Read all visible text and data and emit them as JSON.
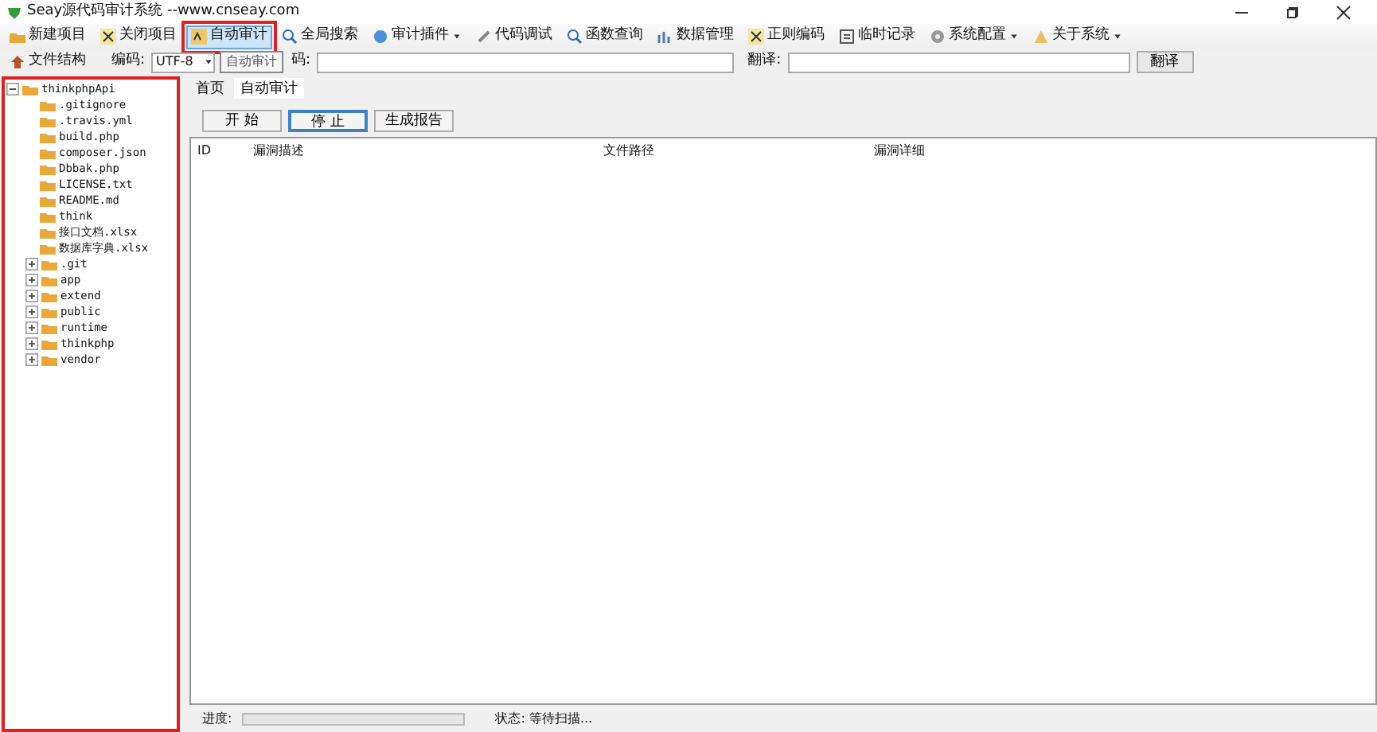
{
  "window": {
    "title": "Seay源代码审计系统 --www.cnseay.com"
  },
  "toolbar": [
    {
      "label": "新建项目",
      "dropdown": false,
      "highlighted": false
    },
    {
      "label": "关闭项目",
      "dropdown": false,
      "highlighted": false
    },
    {
      "label": "自动审计",
      "dropdown": false,
      "highlighted": true
    },
    {
      "label": "全局搜索",
      "dropdown": false,
      "highlighted": false
    },
    {
      "label": "审计插件",
      "dropdown": true,
      "highlighted": false
    },
    {
      "label": "代码调试",
      "dropdown": false,
      "highlighted": false
    },
    {
      "label": "函数查询",
      "dropdown": false,
      "highlighted": false
    },
    {
      "label": "数据管理",
      "dropdown": false,
      "highlighted": false
    },
    {
      "label": "正则编码",
      "dropdown": false,
      "highlighted": false
    },
    {
      "label": "临时记录",
      "dropdown": false,
      "highlighted": false
    },
    {
      "label": "系统配置",
      "dropdown": true,
      "highlighted": false
    },
    {
      "label": "关于系统",
      "dropdown": true,
      "highlighted": false
    }
  ],
  "toolbar2": {
    "structure_button": "文件结构",
    "encoding_label": "编码:",
    "encoding_value": "UTF-8",
    "source_label": "码:",
    "translate_label": "翻译:",
    "translate_button": "翻译"
  },
  "tooltip": "自动审计",
  "tree": {
    "highlighted": true,
    "items": [
      {
        "label": "thinkphpApi",
        "kind": "folder",
        "expanded": true,
        "children": [
          {
            "label": ".gitignore",
            "kind": "file"
          },
          {
            "label": ".travis.yml",
            "kind": "file"
          },
          {
            "label": "build.php",
            "kind": "file"
          },
          {
            "label": "composer.json",
            "kind": "file"
          },
          {
            "label": "Dbbak.php",
            "kind": "file"
          },
          {
            "label": "LICENSE.txt",
            "kind": "file"
          },
          {
            "label": "README.md",
            "kind": "file"
          },
          {
            "label": "think",
            "kind": "file"
          },
          {
            "label": "接口文档.xlsx",
            "kind": "file"
          },
          {
            "label": "数据库字典.xlsx",
            "kind": "file"
          },
          {
            "label": ".git",
            "kind": "folder",
            "expanded": false
          },
          {
            "label": "app",
            "kind": "folder",
            "expanded": false
          },
          {
            "label": "extend",
            "kind": "folder",
            "expanded": false
          },
          {
            "label": "public",
            "kind": "folder",
            "expanded": false
          },
          {
            "label": "runtime",
            "kind": "folder",
            "expanded": false
          },
          {
            "label": "thinkphp",
            "kind": "folder",
            "expanded": false
          },
          {
            "label": "vendor",
            "kind": "folder",
            "expanded": false
          }
        ]
      }
    ]
  },
  "tabs": [
    {
      "label": "首页",
      "selected": false
    },
    {
      "label": "自动审计",
      "selected": true
    }
  ],
  "actions": [
    {
      "label": "开 始",
      "focused": false
    },
    {
      "label": "停 止",
      "focused": true
    },
    {
      "label": "生成报告",
      "focused": false
    }
  ],
  "table": {
    "columns": [
      "ID",
      "漏洞描述",
      "文件路径",
      "漏洞详细"
    ]
  },
  "status_bar": {
    "progress_label": "进度:",
    "level": 0,
    "status": "状态: 等待扫描..."
  }
}
